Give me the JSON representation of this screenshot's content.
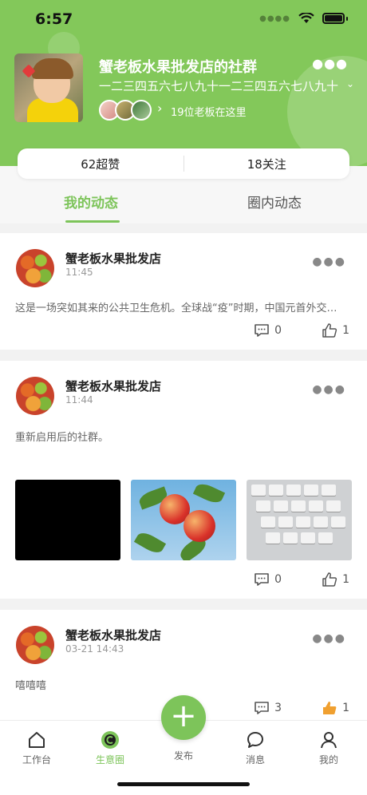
{
  "status": {
    "time": "6:57"
  },
  "group": {
    "title": "蟹老板水果批发店的社群",
    "description": "一二三四五六七八九十一二三四五六七八九十",
    "members_text": "19位老板在这里"
  },
  "stats": {
    "likes": "62超赞",
    "follows": "18关注"
  },
  "tabs": {
    "mine": "我的动态",
    "circle": "圈内动态"
  },
  "posts": [
    {
      "author": "蟹老板水果批发店",
      "time": "11:45",
      "text": "这是一场突如其来的公共卫生危机。全球战“疫”时期，中国元首外交不断",
      "comments": "0",
      "likes": "1"
    },
    {
      "author": "蟹老板水果批发店",
      "time": "11:44",
      "text": "重新启用后的社群。",
      "comments": "0",
      "likes": "1"
    },
    {
      "author": "蟹老板水果批发店",
      "time": "03-21 14:43",
      "text": "嘻嘻嘻",
      "comments": "3",
      "likes": "1"
    }
  ],
  "tabbar": {
    "workbench": "工作台",
    "business_circle": "生意圈",
    "publish": "发布",
    "messages": "消息",
    "mine": "我的"
  },
  "colors": {
    "accent": "#7dc45a",
    "header": "#83c85a"
  },
  "icons": [
    "wifi-icon",
    "battery-icon",
    "more-icon",
    "chevron-right-icon",
    "comment-icon",
    "thumbs-up-icon",
    "home-icon",
    "circle-c-icon",
    "plus-icon",
    "chat-icon",
    "person-icon"
  ]
}
